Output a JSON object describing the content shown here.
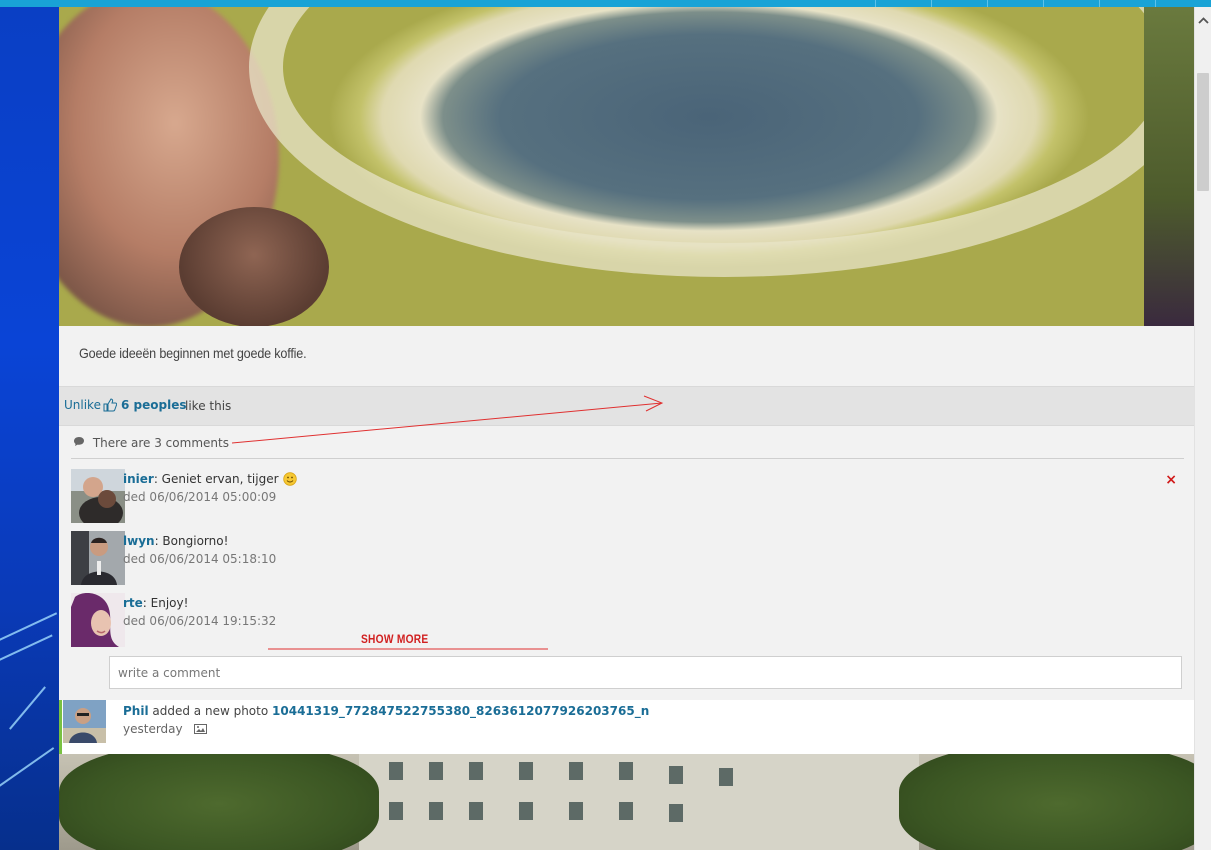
{
  "post": {
    "caption": "Goede ideeën beginnen met goede koffie.",
    "unlike_label": "Unlike",
    "like_count": "6 peoples",
    "like_suffix": "like this",
    "comments_header": "There are 3 comments",
    "comments": [
      {
        "author": "inier",
        "text": ": Geniet ervan, tijger",
        "date": "ded 06/06/2014 05:00:09",
        "emoji": "smiley-icon"
      },
      {
        "author": "lwyn",
        "text": ": Bongiorno!",
        "date": "ded 06/06/2014 05:18:10"
      },
      {
        "author": "rte",
        "text": ": Enjoy!",
        "date": "ded 06/06/2014 19:15:32"
      }
    ],
    "delete_label": "×",
    "show_more": "SHOW MORE",
    "comment_placeholder": "write a comment"
  },
  "next_post": {
    "author": "Phil",
    "action": " added a new photo ",
    "photo_name": "10441319_772847522755380_8263612077926203765_n",
    "time": "yesterday",
    "icon": "image-icon"
  },
  "colors": {
    "accent": "#19a3d6",
    "link": "#1a6d96",
    "danger": "#d11a1a",
    "activity_bar": "#79c142"
  }
}
